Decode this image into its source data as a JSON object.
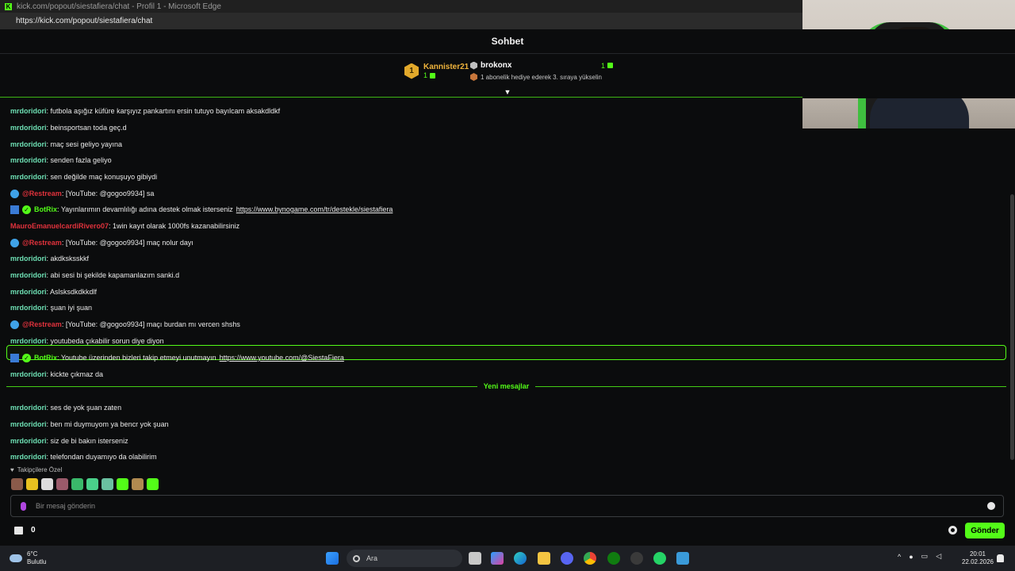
{
  "window": {
    "title": "kick.com/popout/siestafiera/chat - Profil 1 - Microsoft Edge",
    "url": "https://kick.com/popout/siestafiera/chat"
  },
  "header": {
    "title": "Sohbet"
  },
  "leaderboard": {
    "first": {
      "rank": "1",
      "name": "Kannister21",
      "count": "1"
    },
    "second": {
      "name": "brokonx",
      "count": "1",
      "hint": "1 abonelik hediye ederek 3. sıraya yükselin"
    }
  },
  "messages": [
    {
      "user": "mrdoridori",
      "color": "#6ee0b4",
      "text": ": futbola aşığız küfüre karşıyız pankartını ersin tutuyo bayılcam aksakdldkf"
    },
    {
      "user": "mrdoridori",
      "color": "#6ee0b4",
      "text": ": beinsportsan toda geç.d"
    },
    {
      "user": "mrdoridori",
      "color": "#6ee0b4",
      "text": ": maç sesi geliyo yayına"
    },
    {
      "user": "mrdoridori",
      "color": "#6ee0b4",
      "text": ": senden fazla geliyo"
    },
    {
      "user": "mrdoridori",
      "color": "#6ee0b4",
      "text": ": sen değilde maç konuşuyo gibiydi"
    },
    {
      "user": "@Restream",
      "color": "#e0323c",
      "text": ": [YouTube: @gogoo9934] sa",
      "icon": "restream"
    },
    {
      "user": "BotRix",
      "color": "#53fc18",
      "text": ": Yayınlarımın devamlılığı adına destek olmak isterseniz ",
      "link": "https://www.bynogame.com/tr/destekle/siestafiera",
      "icon": "botrix"
    },
    {
      "user": "MauroEmanuelcardiRivero07",
      "color": "#e0323c",
      "text": ": 1win kayıt olarak 1000fs kazanabilirsiniz"
    },
    {
      "user": "@Restream",
      "color": "#e0323c",
      "text": ": [YouTube: @gogoo9934] maç nolur dayı",
      "icon": "restream"
    },
    {
      "user": "mrdoridori",
      "color": "#6ee0b4",
      "text": ": akdksksskkf"
    },
    {
      "user": "mrdoridori",
      "color": "#6ee0b4",
      "text": ": abi sesi bi şekilde kapamanlazım sanki.d"
    },
    {
      "user": "mrdoridori",
      "color": "#6ee0b4",
      "text": ": Aslsksdkdkkdlf"
    },
    {
      "user": "mrdoridori",
      "color": "#6ee0b4",
      "text": ": şuan iyi şuan"
    },
    {
      "user": "@Restream",
      "color": "#e0323c",
      "text": ": [YouTube: @gogoo9934] maçı burdan mı vercen shshs",
      "icon": "restream"
    },
    {
      "user": "mrdoridori",
      "color": "#6ee0b4",
      "text": ": youtubeda çıkabilir sorun diye diyon"
    },
    {
      "user": "BotRix",
      "color": "#53fc18",
      "text": ": Youtube üzerinden bizleri takip etmeyi unutmayın ",
      "link": "https://www.youtube.com/@SiestaFiera",
      "icon": "botrix"
    },
    {
      "user": "mrdoridori",
      "color": "#6ee0b4",
      "text": ": kickte çıkmaz da"
    },
    {
      "user": "mrdoridori",
      "color": "#6ee0b4",
      "text": ": ses de yok şuan zaten"
    },
    {
      "user": "mrdoridori",
      "color": "#6ee0b4",
      "text": ": ben mi duymuyom ya bencr yok şuan"
    },
    {
      "user": "mrdoridori",
      "color": "#6ee0b4",
      "text": ": siz de bi bakın isterseniz"
    },
    {
      "user": "mrdoridori",
      "color": "#6ee0b4",
      "text": ": telefondan duyamıyo da olabilirim"
    }
  ],
  "new_messages_label": "Yeni mesajlar",
  "followers_only": "Takipçilere Özel",
  "input": {
    "placeholder": "Bir mesaj gönderin"
  },
  "footer": {
    "points": "0",
    "send_label": "Gönder"
  },
  "taskbar": {
    "weather_temp": "6°C",
    "weather_desc": "Bulutlu",
    "search_label": "Ara",
    "time": "20:01",
    "date": "22.02.2026"
  },
  "colors": {
    "accent": "#53fc18",
    "background": "#0b0c0d"
  }
}
